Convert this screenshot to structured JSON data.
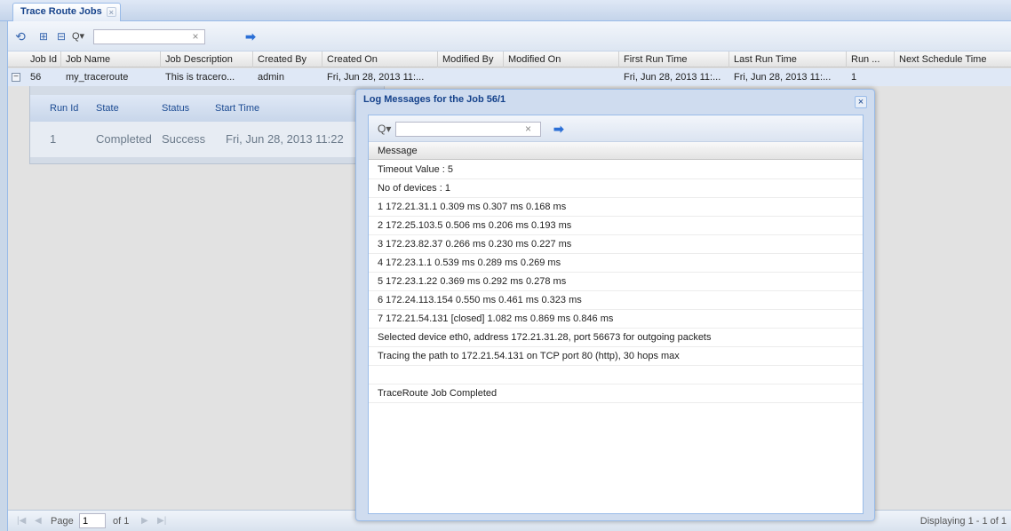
{
  "tab": {
    "label": "Trace Route Jobs",
    "close": "×"
  },
  "toolbar": {
    "refresh_icon": "⟲",
    "icon2": "⊞",
    "icon3": "⊟",
    "search_icon": "Q▾",
    "search_value": "",
    "clear": "×",
    "go": "➡"
  },
  "grid": {
    "columns": [
      "Job Id",
      "Job Name",
      "Job Description",
      "Created By",
      "Created On",
      "Modified By",
      "Modified On",
      "First Run Time",
      "Last Run Time",
      "Run ...",
      "Next Schedule Time"
    ],
    "rows": [
      {
        "job_id": "56",
        "job_name": "my_traceroute",
        "job_description": "This is tracero...",
        "created_by": "admin",
        "created_on": "Fri, Jun 28, 2013 11:...",
        "modified_by": "",
        "modified_on": "",
        "first_run_time": "Fri, Jun 28, 2013 11:...",
        "last_run_time": "Fri, Jun 28, 2013 11:...",
        "run": "1",
        "next_schedule_time": ""
      }
    ]
  },
  "subgrid": {
    "columns": [
      "Run Id",
      "State",
      "Status",
      "Start Time"
    ],
    "rows": [
      {
        "run_id": "1",
        "state": "Completed",
        "status": "Success",
        "start_time": "Fri, Jun 28, 2013 11:22"
      }
    ]
  },
  "paging": {
    "page_label": "Page",
    "page_value": "1",
    "of_label": "of 1",
    "displaying": "Displaying 1 - 1 of 1"
  },
  "dialog": {
    "title": "Log Messages for the Job 56/1",
    "close": "×",
    "search_icon": "Q▾",
    "search_value": "",
    "clear": "×",
    "go": "➡",
    "column": "Message",
    "messages": [
      "Timeout Value : 5",
      "No of devices : 1",
      "1 172.21.31.1 0.309 ms 0.307 ms 0.168 ms",
      "2 172.25.103.5 0.506 ms 0.206 ms 0.193 ms",
      "3 172.23.82.37 0.266 ms 0.230 ms 0.227 ms",
      "4 172.23.1.1 0.539 ms 0.289 ms 0.269 ms",
      "5 172.23.1.22 0.369 ms 0.292 ms 0.278 ms",
      "6 172.24.113.154 0.550 ms 0.461 ms 0.323 ms",
      "7 172.21.54.131 [closed] 1.082 ms 0.869 ms 0.846 ms",
      "Selected device eth0, address 172.21.31.28, port 56673 for outgoing packets",
      "Tracing the path to 172.21.54.131 on TCP port 80 (http), 30 hops max",
      "",
      "TraceRoute Job Completed"
    ]
  },
  "colors": {
    "header_text": "#15428b",
    "accent": "#2b6fd6",
    "selected_row": "#dfe8f6"
  }
}
